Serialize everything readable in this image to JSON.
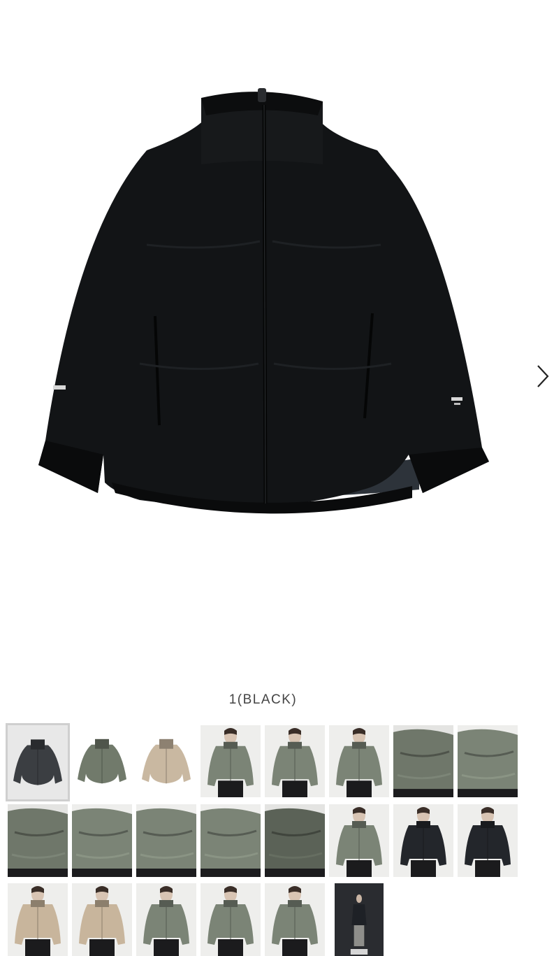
{
  "product": {
    "color_caption": "1(BLACK)",
    "main_image_icon": "black-insulated-jacket",
    "next_arrow_icon": "chevron-right-icon"
  },
  "thumbnails": [
    {
      "label": "jacket-charcoal-front",
      "color": "#3b3e42",
      "type": "flat",
      "bg": "#e8e8e8"
    },
    {
      "label": "jacket-olive-front",
      "color": "#717a6b",
      "type": "flat",
      "bg": "#ffffff"
    },
    {
      "label": "jacket-beige-front",
      "color": "#c9b8a1",
      "type": "flat",
      "bg": "#ffffff"
    },
    {
      "label": "model-olive-front",
      "color": "#7b8476",
      "type": "model",
      "bg": "#eeeeec"
    },
    {
      "label": "model-olive-side",
      "color": "#7b8476",
      "type": "model",
      "bg": "#eeeeec"
    },
    {
      "label": "model-olive-back",
      "color": "#7b8476",
      "type": "model",
      "bg": "#eeeeec"
    },
    {
      "label": "olive-collar-detail",
      "color": "#6f776a",
      "type": "detail",
      "bg": "#e4e4e2"
    },
    {
      "label": "olive-sleeve-detail",
      "color": "#7b8476",
      "type": "detail",
      "bg": "#eeeeec"
    },
    {
      "label": "olive-cuff-detail",
      "color": "#6f776a",
      "type": "detail",
      "bg": "#e4e4e2"
    },
    {
      "label": "olive-sleeve-back",
      "color": "#7b8476",
      "type": "detail",
      "bg": "#eeeeec"
    },
    {
      "label": "olive-pocket-detail",
      "color": "#7b8476",
      "type": "detail",
      "bg": "#eeeeec"
    },
    {
      "label": "olive-arm-logo",
      "color": "#7b8476",
      "type": "detail",
      "bg": "#eeeeec"
    },
    {
      "label": "olive-lining-open",
      "color": "#5b6257",
      "type": "detail",
      "bg": "#e4e4e2"
    },
    {
      "label": "model-olive-hood",
      "color": "#7b8476",
      "type": "model",
      "bg": "#eeeeec"
    },
    {
      "label": "model-black-front",
      "color": "#23262b",
      "type": "model",
      "bg": "#eeeeec"
    },
    {
      "label": "model-black-back",
      "color": "#23262b",
      "type": "model",
      "bg": "#eeeeec"
    },
    {
      "label": "model-beige-front",
      "color": "#c8b59c",
      "type": "model",
      "bg": "#eeeeec"
    },
    {
      "label": "model-beige-back",
      "color": "#c8b59c",
      "type": "model",
      "bg": "#eeeeec"
    },
    {
      "label": "model-olive-front-2",
      "color": "#7b8476",
      "type": "model",
      "bg": "#eeeeec"
    },
    {
      "label": "model-olive-side-2",
      "color": "#7b8476",
      "type": "model",
      "bg": "#eeeeec"
    },
    {
      "label": "model-olive-back-2",
      "color": "#7b8476",
      "type": "model",
      "bg": "#eeeeec"
    },
    {
      "label": "model-studio-full",
      "color": "#1e2126",
      "type": "studio",
      "bg": "#2a2c30"
    }
  ]
}
